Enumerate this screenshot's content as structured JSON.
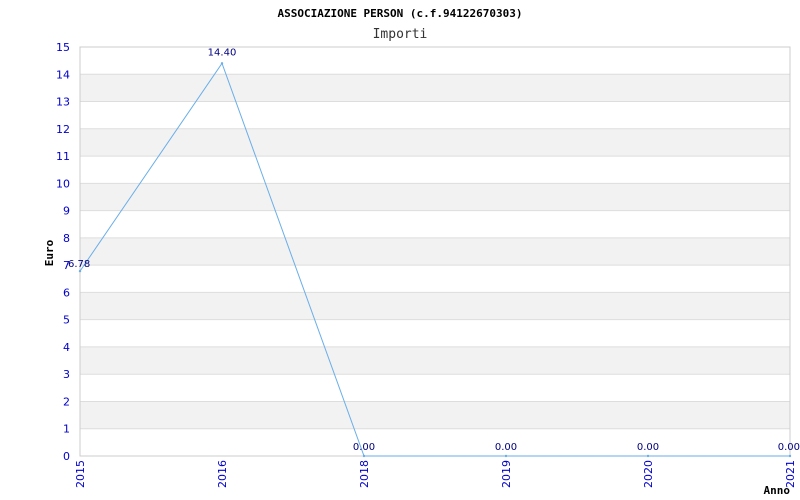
{
  "chart_data": {
    "type": "line",
    "title": "ASSOCIAZIONE PERSON (c.f.94122670303)",
    "subtitle": "Importi",
    "xlabel": "Anno",
    "ylabel": "Euro",
    "categories": [
      "2015",
      "2016",
      "2018",
      "2019",
      "2020",
      "2021"
    ],
    "series": [
      {
        "values": [
          6.78,
          14.4,
          0.0,
          0.0,
          0.0,
          0.0
        ]
      }
    ],
    "data_labels": [
      "6.78",
      "14.40",
      "0.00",
      "0.00",
      "0.00",
      "0.00"
    ],
    "yticks": [
      "0",
      "1",
      "2",
      "3",
      "4",
      "5",
      "6",
      "7",
      "8",
      "9",
      "10",
      "11",
      "12",
      "13",
      "14",
      "15"
    ],
    "ylim": [
      0,
      15
    ],
    "grid": "horizontal alternating bands",
    "legend": "none",
    "colors": {
      "line": "#6aaee8",
      "band": "#f2f2f2",
      "gridline": "#dddddd",
      "tick_text": "#0000cc",
      "data_label": "#000080"
    }
  }
}
